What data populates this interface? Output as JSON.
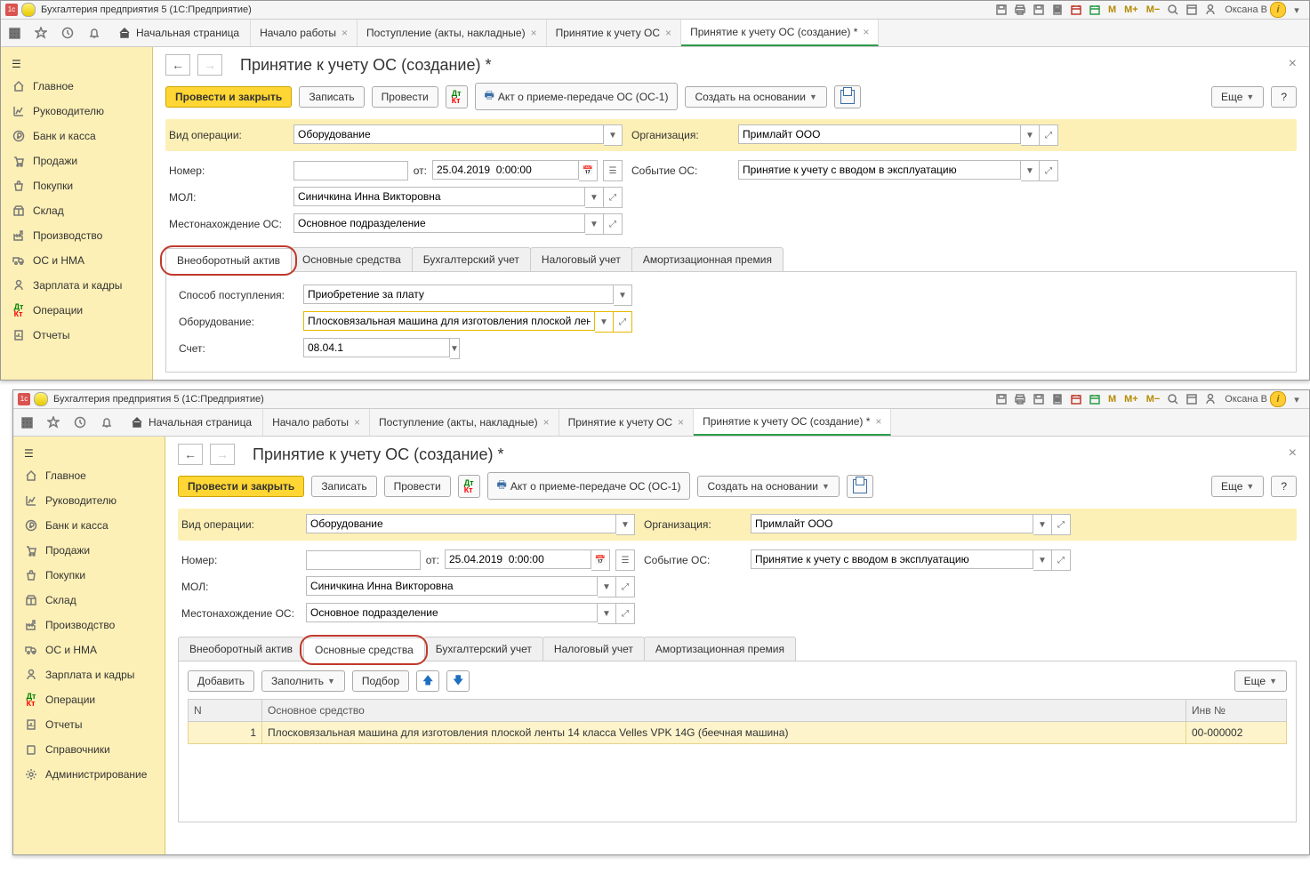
{
  "window_title": "Бухгалтерия предприятия 5   (1С:Предприятие)",
  "user_name": "Оксана В",
  "tb_buttons": [
    "M",
    "M+",
    "M−"
  ],
  "home_tab": "Начальная страница",
  "tabs": [
    {
      "label": "Начало работы"
    },
    {
      "label": "Поступление (акты, накладные)"
    },
    {
      "label": "Принятие к учету ОС"
    },
    {
      "label": "Принятие к учету ОС (создание) *"
    }
  ],
  "sidebar": [
    {
      "icon": "home",
      "label": "Главное"
    },
    {
      "icon": "chart",
      "label": "Руководителю"
    },
    {
      "icon": "ruble",
      "label": "Банк и касса"
    },
    {
      "icon": "cart",
      "label": "Продажи"
    },
    {
      "icon": "basket",
      "label": "Покупки"
    },
    {
      "icon": "box",
      "label": "Склад"
    },
    {
      "icon": "factory",
      "label": "Производство"
    },
    {
      "icon": "truck",
      "label": "ОС и НМА"
    },
    {
      "icon": "person",
      "label": "Зарплата и кадры"
    },
    {
      "icon": "dtkt",
      "label": "Операции"
    },
    {
      "icon": "report",
      "label": "Отчеты"
    },
    {
      "icon": "book",
      "label": "Справочники"
    },
    {
      "icon": "gear",
      "label": "Администрирование"
    }
  ],
  "page_title": "Принятие к учету ОС (создание) *",
  "toolbar": {
    "post_close": "Провести и закрыть",
    "save": "Записать",
    "post": "Провести",
    "print_report": "Акт о приеме-передаче ОС (ОС-1)",
    "create_based": "Создать на основании",
    "more": "Еще",
    "help": "?"
  },
  "form": {
    "op_type_label": "Вид операции:",
    "op_type_value": "Оборудование",
    "org_label": "Организация:",
    "org_value": "Примлайт ООО",
    "number_label": "Номер:",
    "number_value": "",
    "from_label": "от:",
    "date_value": "25.04.2019  0:00:00",
    "event_label": "Событие ОС:",
    "event_value": "Принятие к учету с вводом в эксплуатацию",
    "mol_label": "МОЛ:",
    "mol_value": "Синичкина Инна Викторовна",
    "location_label": "Местонахождение ОС:",
    "location_value": "Основное подразделение"
  },
  "inner_tabs": [
    "Внеоборотный актив",
    "Основные средства",
    "Бухгалтерский учет",
    "Налоговый учет",
    "Амортизационная премия"
  ],
  "tab1": {
    "receipt_label": "Способ поступления:",
    "receipt_value": "Приобретение за плату",
    "equipment_label": "Оборудование:",
    "equipment_value": "Плосковязальная машина для изготовления плоской лент",
    "account_label": "Счет:",
    "account_value": "08.04.1"
  },
  "tab2_toolbar": {
    "add": "Добавить",
    "fill": "Заполнить",
    "select": "Подбор",
    "more": "Еще"
  },
  "tab2_table": {
    "col_n": "N",
    "col_asset": "Основное средство",
    "col_inv": "Инв №",
    "rows": [
      {
        "n": "1",
        "asset": "Плосковязальная машина для изготовления плоской ленты 14 класса Velles VPK 14G (беечная машина)",
        "inv": "00-000002"
      }
    ]
  }
}
